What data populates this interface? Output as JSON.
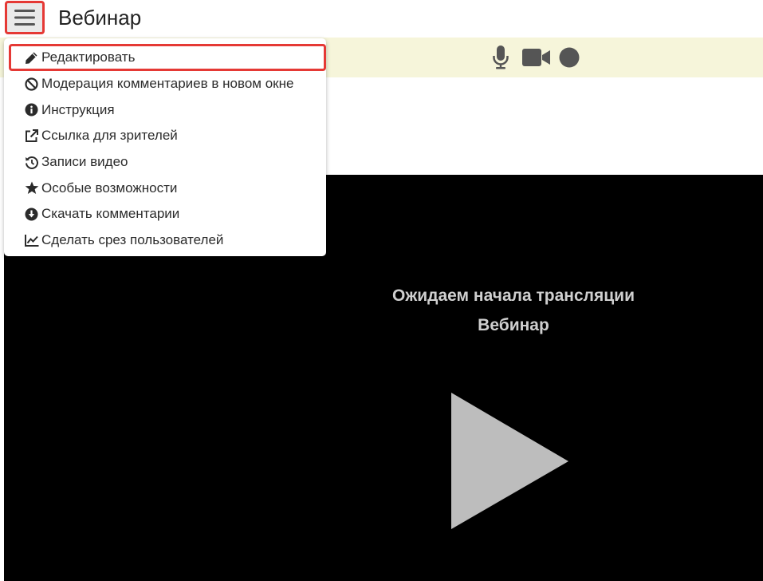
{
  "header": {
    "title": "Вебинар",
    "menu_icon": "hamburger-menu-icon"
  },
  "media_bar": {
    "icons": [
      "microphone-icon",
      "video-camera-icon",
      "record-icon"
    ]
  },
  "dropdown": {
    "items": [
      {
        "label": "Редактировать",
        "icon": "pencil-icon"
      },
      {
        "label": "Модерация комментариев в новом окне",
        "icon": "ban-icon"
      },
      {
        "label": "Инструкция",
        "icon": "info-circle-icon"
      },
      {
        "label": "Ссылка для зрителей",
        "icon": "external-link-icon"
      },
      {
        "label": "Записи видео",
        "icon": "history-icon"
      },
      {
        "label": "Особые возможности",
        "icon": "star-icon"
      },
      {
        "label": "Скачать комментарии",
        "icon": "download-circle-icon"
      },
      {
        "label": "Сделать срез пользователей",
        "icon": "line-chart-icon"
      }
    ]
  },
  "player": {
    "status_text": "Ожидаем начала трансляции",
    "webinar_name": "Вебинар",
    "play_icon": "play-icon"
  },
  "colors": {
    "highlight": "#e53935",
    "media_bar_bg": "#f6f5da",
    "player_bg": "#000000",
    "player_text": "#cfcfcf"
  }
}
